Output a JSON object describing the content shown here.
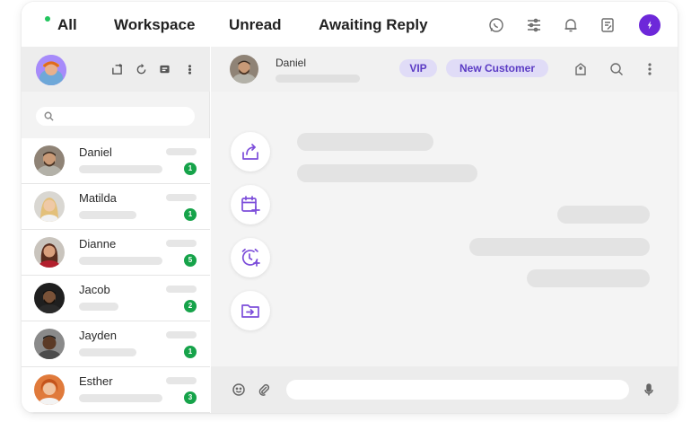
{
  "topbar": {
    "tabs": [
      {
        "label": "All",
        "active": true
      },
      {
        "label": "Workspace"
      },
      {
        "label": "Unread"
      },
      {
        "label": "Awaiting Reply"
      }
    ],
    "icons": [
      "whatsapp-icon",
      "sliders-icon",
      "bell-icon",
      "notes-icon",
      "brand-logo-icon"
    ],
    "status_color": "#22c55e",
    "brand_color": "#6d28d9"
  },
  "sidebar": {
    "tools": [
      "share-icon",
      "refresh-icon",
      "chat-icon",
      "more-vertical-icon"
    ],
    "search": {
      "placeholder": ""
    },
    "contacts": [
      {
        "name": "Daniel",
        "unread": "1"
      },
      {
        "name": "Matilda",
        "unread": "1"
      },
      {
        "name": "Dianne",
        "unread": "5"
      },
      {
        "name": "Jacob",
        "unread": "2"
      },
      {
        "name": "Jayden",
        "unread": "1"
      },
      {
        "name": "Esther",
        "unread": "3"
      }
    ],
    "badge_color": "#16a34a"
  },
  "chat": {
    "contact_name": "Daniel",
    "tags": [
      "VIP",
      "New Customer"
    ],
    "header_icons": [
      "tag-icon",
      "search-icon",
      "more-vertical-icon"
    ],
    "actions": [
      "export-icon",
      "calendar-add-icon",
      "alarm-add-icon",
      "folder-move-icon"
    ],
    "accent_color": "#7c4dda",
    "composer": {
      "placeholder": "",
      "icons": [
        "emoji-icon",
        "attach-icon",
        "microphone-icon"
      ]
    }
  }
}
